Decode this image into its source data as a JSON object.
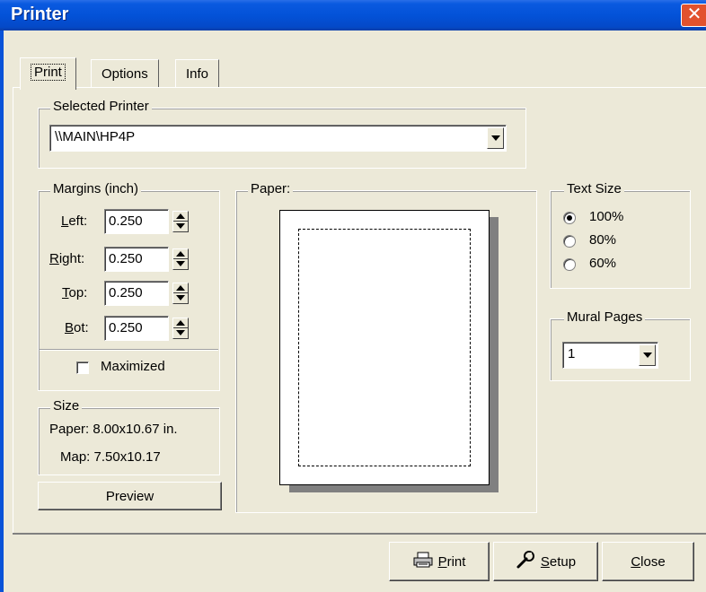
{
  "window": {
    "title": "Printer"
  },
  "tabs": [
    {
      "label": "Print",
      "active": true
    },
    {
      "label": "Options",
      "active": false
    },
    {
      "label": "Info",
      "active": false
    }
  ],
  "selected_printer": {
    "group_title": "Selected Printer",
    "value": "\\\\MAIN\\HP4P"
  },
  "margins": {
    "group_title": "Margins (inch)",
    "fields": [
      {
        "label_mnemonic": "L",
        "label_rest": "eft:",
        "value": "0.250"
      },
      {
        "label_mnemonic": "R",
        "label_rest": "ight:",
        "value": "0.250"
      },
      {
        "label_mnemonic": "T",
        "label_rest": "op:",
        "value": "0.250"
      },
      {
        "label_mnemonic": "B",
        "label_rest": "ot:",
        "value": "0.250"
      }
    ],
    "maximized_label": "Maximized",
    "maximized_checked": false
  },
  "size": {
    "group_title": "Size",
    "paper_line": "Paper:  8.00x10.67 in.",
    "map_line": "Map:  7.50x10.17"
  },
  "paper_group_title": "Paper:",
  "text_size": {
    "group_title": "Text Size",
    "options": [
      {
        "label": "100%",
        "checked": true
      },
      {
        "label": "80%",
        "checked": false
      },
      {
        "label": "60%",
        "checked": false
      }
    ]
  },
  "mural_pages": {
    "group_title": "Mural Pages",
    "value": "1"
  },
  "buttons": {
    "preview": "Preview",
    "print_mnemonic": "P",
    "print_rest": "rint",
    "setup_mnemonic": "S",
    "setup_rest": "etup",
    "close_mnemonic": "C",
    "close_rest": "lose"
  },
  "icons": {
    "close": "close-icon",
    "print": "printer-icon",
    "setup": "wrench-icon"
  },
  "colors": {
    "titlebar": "#0352D8",
    "close_button": "#E2522D",
    "face": "#ECE9D8"
  }
}
